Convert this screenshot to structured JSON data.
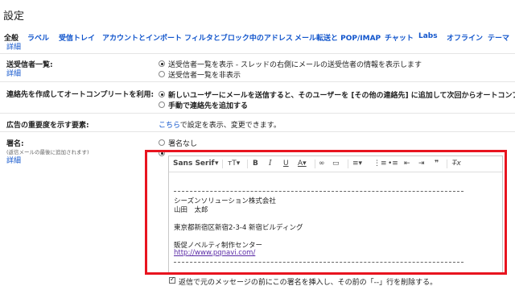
{
  "page_title": "設定",
  "tabs": [
    "全般",
    "ラベル",
    "受信トレイ",
    "アカウントとインポート",
    "フィルタとブロック中のアドレス",
    "メール転送と POP/IMAP",
    "チャット",
    "Labs",
    "オフライン",
    "テーマ"
  ],
  "tab_sub": "詳細",
  "sections": {
    "sender_list": {
      "label": "送受信者一覧:",
      "link": "詳細",
      "opt1": "送受信者一覧を表示",
      "opt1_rest": " - スレッドの右側にメールの送受信者の情報を表示します",
      "opt2": "送受信者一覧を非表示"
    },
    "autocomplete": {
      "label": "連絡先を作成してオートコンプリートを利用:",
      "opt1": "新しいユーザーにメールを送信すると、そのユーザーを [その他の連絡先] に追加して次回からオートコンプ",
      "opt2": "手動で連絡先を追加する"
    },
    "ads": {
      "label": "広告の重要度を示す要素:",
      "link": "こちら",
      "text": "で設定を表示、変更できます。"
    },
    "signature": {
      "label": "署名:",
      "note": "(返信メールの最後に追加されます)",
      "link": "詳細",
      "opt_none": "署名なし",
      "font": "Sans Serif",
      "lines": {
        "company": "シーズンソリューション株式会社",
        "name": "山田　太郎",
        "address": "東京都新宿区新宿2-3-4 新宿ビルディング",
        "dept": "販促ノベルティ制作センター",
        "url": "http://www.pqnavi.com/"
      },
      "insert_option": "返信で元のメッセージの前にこの署名を挿入し、その前の「--」行を削除する。"
    }
  },
  "colors": {
    "highlight": "#e8141f",
    "link": "#1155cc"
  }
}
